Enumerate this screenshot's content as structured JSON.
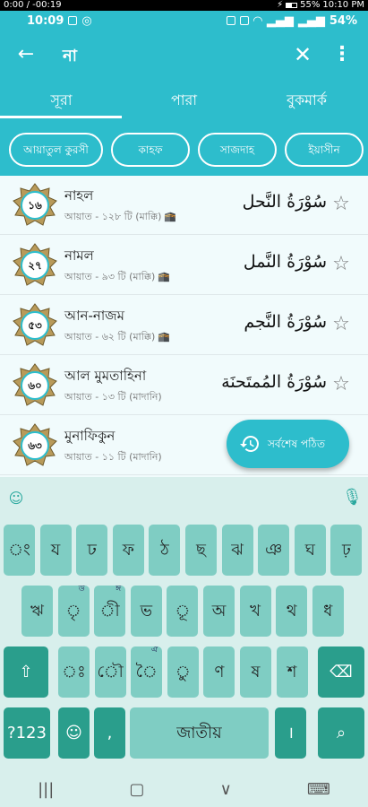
{
  "recorder": {
    "left": "0:00 / -00:19",
    "battery": "55%",
    "time": "10:10 PM"
  },
  "status": {
    "time": "10:09",
    "battery": "54%"
  },
  "toolbar": {
    "query": "না"
  },
  "tabs": [
    {
      "label": "সূরা"
    },
    {
      "label": "পারা"
    },
    {
      "label": "বুকমার্ক"
    }
  ],
  "chips": [
    {
      "label": "আয়াতুল কুরসী"
    },
    {
      "label": "কাহফ"
    },
    {
      "label": "সাজদাহ"
    },
    {
      "label": "ইয়াসীন"
    }
  ],
  "surahs": [
    {
      "num": "১৬",
      "name": "নাহল",
      "meta": "আয়াত - ১২৮ টি (মাক্কি)",
      "kaaba": true,
      "arabic": "سُوْرَةُ النَّحل"
    },
    {
      "num": "২৭",
      "name": "নামল",
      "meta": "আয়াত - ৯৩ টি (মাক্কি)",
      "kaaba": true,
      "arabic": "سُوْرَةُ النَّمل"
    },
    {
      "num": "৫৩",
      "name": "আন-নাজম",
      "meta": "আয়াত - ৬২ টি (মাক্কি)",
      "kaaba": true,
      "arabic": "سُوْرَةُ النَّجم"
    },
    {
      "num": "৬০",
      "name": "আল মুমতাহিনা",
      "meta": "আয়াত - ১৩ টি (মাদানি)",
      "kaaba": false,
      "arabic": "سُوْرَةُ المُمتَحنَة"
    },
    {
      "num": "৬৩",
      "name": "মুনাফিকুন",
      "meta": "আয়াত - ১১ টি (মাদানি)",
      "kaaba": false,
      "arabic": ""
    }
  ],
  "fab": {
    "label": "সর্বশেষ পঠিত"
  },
  "keyboard": {
    "row1": [
      "ং",
      "য",
      "ঢ",
      "ফ",
      "ঠ",
      "ছ",
      "ঝ",
      "ঞ",
      "ঘ",
      "ঢ়"
    ],
    "row2": [
      "ঋ",
      "ৃ",
      "ী",
      "ভ",
      "ূ",
      "অ",
      "খ",
      "থ",
      "ধ"
    ],
    "row2_hints": [
      "",
      "উ",
      "ঈ",
      "",
      "",
      "",
      "",
      "",
      ""
    ],
    "row3": [
      "ঃ",
      "ৌ",
      "ৈ",
      "ু",
      "ণ",
      "ষ",
      "শ"
    ],
    "row3_hints": [
      "",
      "",
      "ঐ",
      "",
      "",
      "",
      ""
    ],
    "numbers_label": "?123",
    "comma": ",",
    "space_label": "জাতীয়",
    "period": "।"
  },
  "kaaba_symbol": "🕋"
}
